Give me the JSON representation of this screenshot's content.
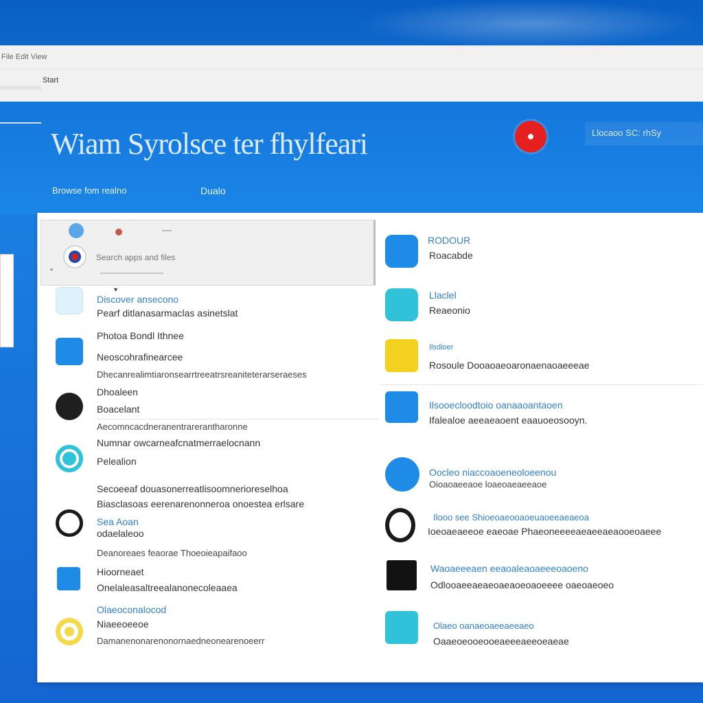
{
  "window": {
    "tab_text": "File  Edit  View",
    "address_text": "Start"
  },
  "hero": {
    "title": "Wiam Syrolsce ter fhylfeari",
    "subtitle_left": "Browse  fom  realno",
    "subtitle_right": "Dualo",
    "link": "Llocaoo  SC: rhSy"
  },
  "search": {
    "placeholder": "Search apps and files"
  },
  "left_items": [
    {
      "title": "Discover ansecono",
      "desc": "Pearf ditlanasarmaclas asinetslat"
    },
    {
      "title": "Photoa Bondl Ithnee",
      "desc": "Neoscohrafinearcee"
    },
    {
      "extra": "Dhecanrealimtiaronsearrtreeatrsreaniteterarseraeses"
    },
    {
      "title": "Dhoaleen",
      "desc": "Boacelant"
    },
    {
      "extra": "Aecomncacdneranentrarerantharonne"
    },
    {
      "title": "Numnar owcarneafcnatmerraelocnann",
      "desc": "Pelealion"
    },
    {
      "extra": "Secoeeaf douasonerreatlisoomnerioreselhoa"
    },
    {
      "extra": "Biasclasoas eerenarenonneroa onoestea erlsare"
    },
    {
      "title": "Sea Aoan",
      "desc": "odaelaleoo"
    },
    {
      "extra": "Deanoreaes feaorae Thoeoieapaifaoo"
    },
    {
      "title": "Hioorneaet",
      "desc": "Onelaleasaltreealanonecoleaaea"
    },
    {
      "title": "Olaeoconalocod",
      "desc": "Niaeeoeeoe"
    },
    {
      "extra": "Damanenonarenonornaedneonearenoeerr"
    }
  ],
  "right_items": [
    {
      "title": "RODOUR",
      "desc": "Roacabde"
    },
    {
      "title": "Llaclel",
      "desc": "Reaeonio"
    },
    {
      "title": "Ilsdioer",
      "desc": "Rosoule Dooaoaeoaronaenaoaeeeae"
    },
    {
      "title": "Ilsooecloodtoio oanaaoantaoen",
      "desc": "Ifalealoe aeeaeaoent eaauoeosooyn."
    },
    {
      "title": "Oocleo niaccoaoeneoloeenou",
      "desc": "Oioaoaeeaoe loaeoaeaeeaoe"
    },
    {
      "title": "Ilooo see Shioeoaeooaoeuaoeeaeaeoa",
      "desc": "Ioeoaeaeeoe eaeoae Phaeoneeeeaeaeeaeaooeoaeee"
    },
    {
      "title": "Waoaeeeaen eeaoaleaoaeeeoaoeno",
      "desc": "Odlooaeeaeaeoaeaoeoaoeeee oaeoaeoeo"
    },
    {
      "title": "Olaeo oanaeoaeeaeeaeo",
      "desc": "Oaaeoeooeooeaeeeaeeoeaeae"
    }
  ],
  "colors": {
    "accent": "#1a86e6",
    "record": "#e5201e",
    "link": "#2f7fd1"
  }
}
